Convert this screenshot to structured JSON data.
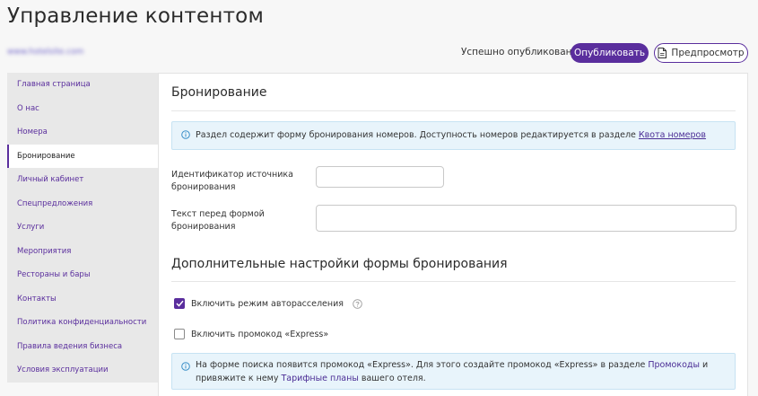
{
  "header": {
    "title": "Управление контентом",
    "site_link": "www.hotelsite.com"
  },
  "topbar": {
    "status": "Успешно опубликовано",
    "publish_label": "Опубликовать",
    "preview_label": "Предпросмотр"
  },
  "sidebar": {
    "items": [
      {
        "label": "Главная страница"
      },
      {
        "label": "О нас"
      },
      {
        "label": "Номера"
      },
      {
        "label": "Бронирование",
        "active": true
      },
      {
        "label": "Личный кабинет"
      },
      {
        "label": "Спецпредложения"
      },
      {
        "label": "Услуги"
      },
      {
        "label": "Мероприятия"
      },
      {
        "label": "Рестораны и бары"
      },
      {
        "label": "Контакты"
      },
      {
        "label": "Политика конфиденциальности"
      },
      {
        "label": "Правила ведения бизнеса"
      },
      {
        "label": "Условия эксплуатации"
      }
    ]
  },
  "main": {
    "section_title": "Бронирование",
    "info1": {
      "text": "Раздел содержит форму бронирования номеров. Доступность номеров редактируется в разделе ",
      "link": "Квота номеров"
    },
    "fields": {
      "source_id_label": "Идентификатор источника бронирования",
      "source_id_value": "",
      "text_before_label": "Текст перед формой бронирования",
      "text_before_value": ""
    },
    "extra_title": "Дополнительные настройки формы бронирования",
    "checkbox_autoassign": {
      "label": "Включить режим авторасселения",
      "checked": true
    },
    "checkbox_express": {
      "label": "Включить промокод «Express»",
      "checked": false
    },
    "info2": {
      "text_a": "На форме поиска появится промокод «Express». Для этого создайте промокод «Express» в разделе ",
      "link_a": "Промокоды",
      "text_b": " и привяжите к нему ",
      "link_b": "Тарифные планы",
      "text_c": " вашего отеля."
    }
  },
  "colors": {
    "accent": "#5a2e9d",
    "info_bg": "#e8f4fb",
    "sidebar_bg": "#e8e8e8"
  },
  "icons": {
    "preview": "document-icon",
    "info": "info-circle-icon",
    "help": "question-circle-icon",
    "check": "checkmark-icon"
  }
}
